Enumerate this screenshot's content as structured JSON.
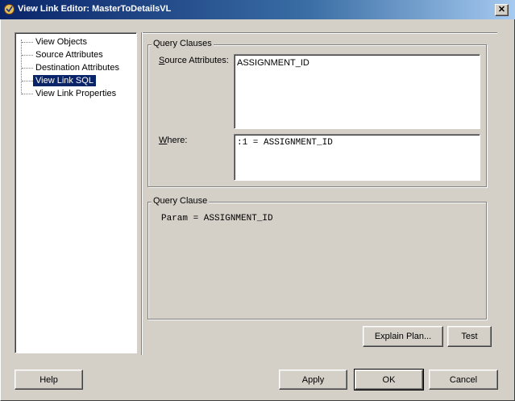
{
  "window": {
    "title": "View Link Editor: MasterToDetailsVL",
    "close_label": "✕"
  },
  "tree": {
    "items": [
      {
        "label": "View Objects",
        "selected": false
      },
      {
        "label": "Source Attributes",
        "selected": false
      },
      {
        "label": "Destination Attributes",
        "selected": false
      },
      {
        "label": "View Link SQL",
        "selected": true
      },
      {
        "label": "View Link Properties",
        "selected": false
      }
    ]
  },
  "query_clauses": {
    "group_label": "Query Clauses",
    "source_attributes_label": "Source Attributes:",
    "source_attributes_value": "ASSIGNMENT_ID",
    "where_label": "Where:",
    "where_value": ":1 = ASSIGNMENT_ID"
  },
  "query_clause": {
    "group_label": "Query Clause",
    "value": "Param = ASSIGNMENT_ID"
  },
  "buttons": {
    "explain_plan": "Explain Plan...",
    "test": "Test",
    "help": "Help",
    "apply": "Apply",
    "ok": "OK",
    "cancel": "Cancel"
  },
  "colors": {
    "title_bar": "#0a246a",
    "selection": "#0a246a",
    "dialog_bg": "#d4d0c8"
  }
}
